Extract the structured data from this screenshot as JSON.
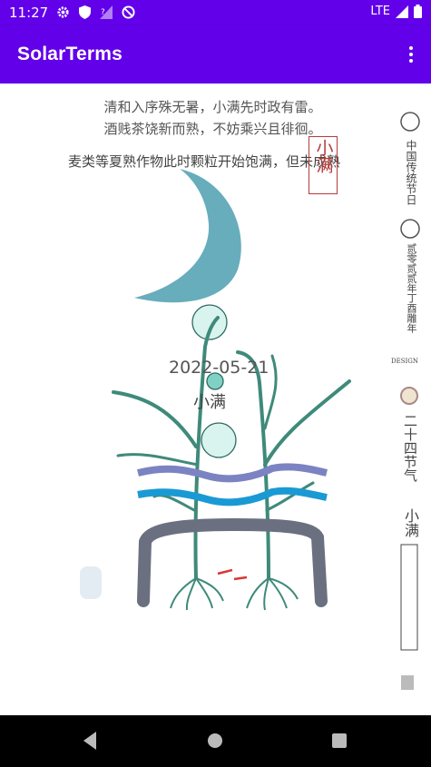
{
  "status_bar": {
    "time": "11:27",
    "network": "LTE",
    "icons": [
      "gear-icon",
      "shield-icon",
      "no-signal-icon",
      "blocked-icon",
      "wifi-icon",
      "signal-icon",
      "battery-icon"
    ]
  },
  "app_bar": {
    "title": "SolarTerms",
    "menu_icon": "more-vert-icon"
  },
  "main": {
    "poem_line1": "清和入序殊无暑，小满先时政有雷。",
    "poem_line2": "酒贱茶饶新而熟，不妨乘兴且徘徊。",
    "description": "麦类等夏熟作物此时颗粒开始饱满，但未成熟",
    "date": "2022-05-21",
    "term_name": "小满",
    "seal_text": "小满",
    "side_text_top": "中国传统节日",
    "side_text_mid": "贰零贰贰年丁酉雕年",
    "side_design": "DESIGN",
    "side_text_main": "二十四节气",
    "side_term": "小满",
    "colors": {
      "moon": "#5fa9b8",
      "stem": "#3f8a7a",
      "band1": "#7c83c2",
      "band2": "#1a9ad4",
      "root_bar": "#6a7080",
      "accent": "#6200ea"
    }
  },
  "nav_bar": {
    "buttons": [
      "back-icon",
      "home-icon",
      "recents-icon"
    ]
  }
}
